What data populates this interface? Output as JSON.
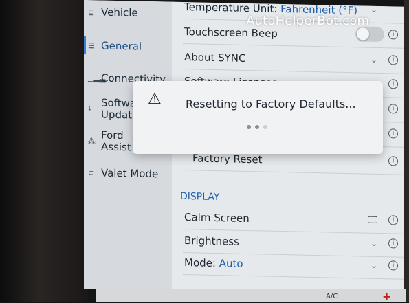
{
  "sidebar": {
    "items": [
      {
        "label": "Vehicle",
        "icon": "car-settings-icon"
      },
      {
        "label": "General",
        "icon": "sliders-icon",
        "active": true
      },
      {
        "label": "Connectivity",
        "icon": "signal-bars-icon"
      },
      {
        "label_line1": "Software",
        "label_line2": "Updates",
        "icon": "download-icon"
      },
      {
        "label_line1": "Ford",
        "label_line2": "Assist",
        "icon": "assist-icon"
      },
      {
        "label": "Valet Mode",
        "icon": "valet-icon"
      }
    ]
  },
  "settings": {
    "temperature_unit_label": "Temperature Unit: ",
    "temperature_unit_value": "Fahrenheit (°F)",
    "touchscreen_beep": "Touchscreen Beep",
    "about_sync": "About SYNC",
    "software_licenses": "Software Licenses",
    "factory_reset": "Factory Reset",
    "display_section": "DISPLAY",
    "calm_screen": "Calm Screen",
    "brightness": "Brightness",
    "mode_label": "Mode: ",
    "mode_value": "Auto"
  },
  "dialog": {
    "message": "Resetting to Factory Defaults...",
    "icon": "warning-triangle-icon"
  },
  "bottom_bar": {
    "ac_label": "A/C"
  },
  "watermark": "AutoHelperBot.com",
  "colors": {
    "accent": "#1f5ea8",
    "active_indicator": "#3b7dd8"
  }
}
